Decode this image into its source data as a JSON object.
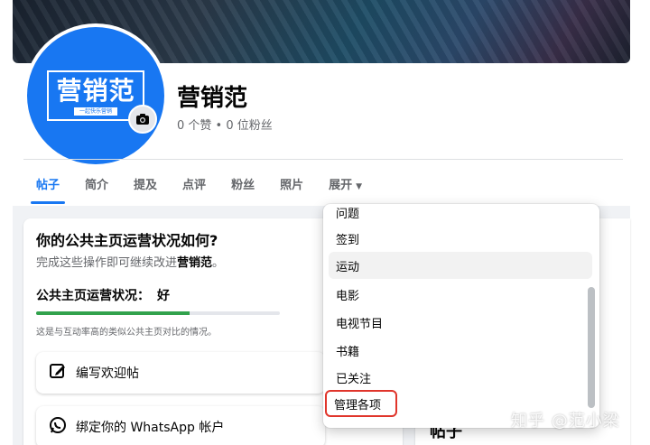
{
  "profile": {
    "logo_text": "营销范",
    "logo_sub": "一起快乐营销",
    "name": "营销范",
    "stats": "0 个赞 • 0 位粉丝"
  },
  "tabs": [
    {
      "label": "帖子",
      "active": true
    },
    {
      "label": "简介"
    },
    {
      "label": "提及"
    },
    {
      "label": "点评"
    },
    {
      "label": "粉丝"
    },
    {
      "label": "照片"
    },
    {
      "label": "展开",
      "caret": "▼"
    }
  ],
  "card": {
    "title": "你的公共主页运营状况如何?",
    "subtitle_prefix": "完成这些操作即可继续改进",
    "subtitle_bold": "营销范",
    "subtitle_suffix": "。",
    "status_label": "公共主页运营状况：",
    "status_value": "好",
    "progress_fraction": 0.63,
    "compare_text": "这是与互动率高的类似公共主页对比的情况。",
    "actions": [
      {
        "label": "编写欢迎帖",
        "icon": "edit-icon"
      },
      {
        "label": "绑定你的 WhatsApp 帐户",
        "icon": "whatsapp-icon"
      }
    ]
  },
  "right": {
    "post_label": "帖子"
  },
  "dropdown": {
    "items": [
      {
        "label": "问题"
      },
      {
        "label": "签到"
      },
      {
        "label": "运动",
        "highlight": true
      },
      {
        "label": "电影"
      },
      {
        "label": "电视节目"
      },
      {
        "label": "书籍"
      },
      {
        "label": "已关注"
      },
      {
        "label": "管理各项",
        "outlined": true
      }
    ]
  },
  "watermark": "知乎 @范小梁",
  "colors": {
    "accent": "#1877f2",
    "progress": "#31a24c",
    "outline": "#e0352b"
  }
}
